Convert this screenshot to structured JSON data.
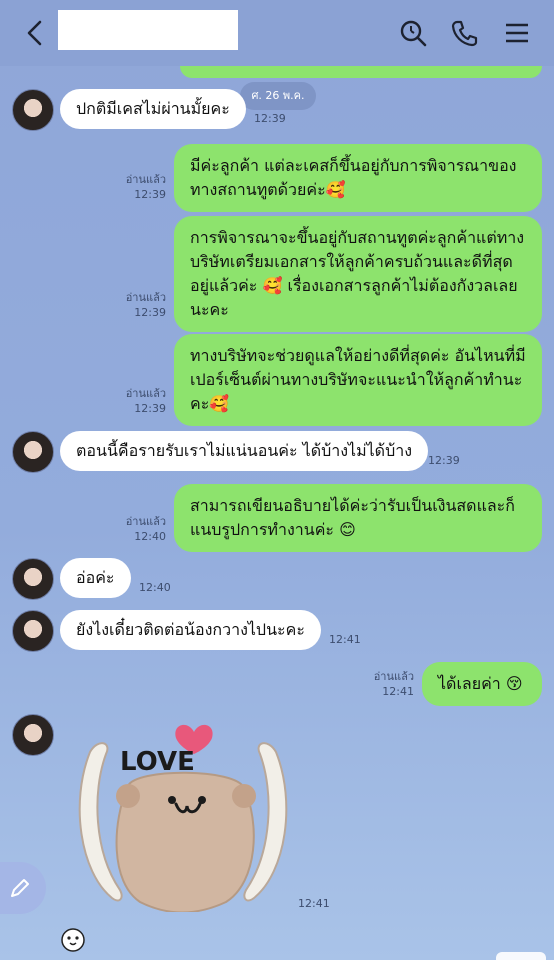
{
  "header": {
    "back_icon": "chevron-left-icon",
    "search_icon": "search-icon",
    "call_icon": "phone-icon",
    "menu_icon": "hamburger-menu-icon"
  },
  "date_pill": "ศ. 26 พ.ค.",
  "messages": [
    {
      "dir": "in",
      "text": "ปกติมีเคสไม่ผ่านมั้ยคะ",
      "time": "12:39"
    },
    {
      "dir": "out",
      "read": "อ่านแล้ว",
      "time": "12:39",
      "lines": [
        "มีค่ะลูกค้า แต่ละเคสก็ขึ้นอยู่กับการพิจารณาของ",
        "ทางสถานทูตด้วยค่ะ🥰"
      ]
    },
    {
      "dir": "out",
      "read": "อ่านแล้ว",
      "time": "12:39",
      "lines": [
        "การพิจารณาจะขึ้นอยู่กับสถานทูตค่ะลูกค้าแต่ทาง",
        "บริษัทเตรียมเอกสารให้ลูกค้าครบถ้วนและดีที่สุด",
        "อยู่แล้วค่ะ 🥰 เรื่องเอกสารลูกค้าไม่ต้องกังวลเลย",
        "นะคะ"
      ]
    },
    {
      "dir": "out",
      "read": "อ่านแล้ว",
      "time": "12:39",
      "lines": [
        "ทางบริษัทจะช่วยดูแลให้อย่างดีที่สุดค่ะ อันไหนที่มี",
        "เปอร์เซ็นต์ผ่านทางบริษัทจะแนะนำให้ลูกค้าทำนะ",
        "คะ🥰"
      ]
    },
    {
      "dir": "in",
      "text": "ตอนนี้คือรายรับเราไม่แน่นอนค่ะ ได้บ้างไม่ได้บ้าง",
      "time": "12:39"
    },
    {
      "dir": "out",
      "read": "อ่านแล้ว",
      "time": "12:40",
      "lines": [
        "สามารถเขียนอธิบายได้ค่ะว่ารับเป็นเงินสดและก็",
        "แนบรูปการทำงานค่ะ 😊"
      ]
    },
    {
      "dir": "in",
      "text": "อ่อค่ะ",
      "time": "12:40"
    },
    {
      "dir": "in",
      "text": "ยังไงเดี๋ยวติดต่อน้องกวางไปนะคะ",
      "time": "12:41"
    },
    {
      "dir": "out",
      "read": "อ่านแล้ว",
      "time": "12:41",
      "lines": [
        "ได้เลยค่า 😚"
      ]
    },
    {
      "dir": "in",
      "sticker": "love-bear-sticker",
      "sticker_text": "LOVE",
      "time": "12:41"
    }
  ],
  "compose_icon": "pencil-icon",
  "small_sticker_icon": "bear-face-icon"
}
